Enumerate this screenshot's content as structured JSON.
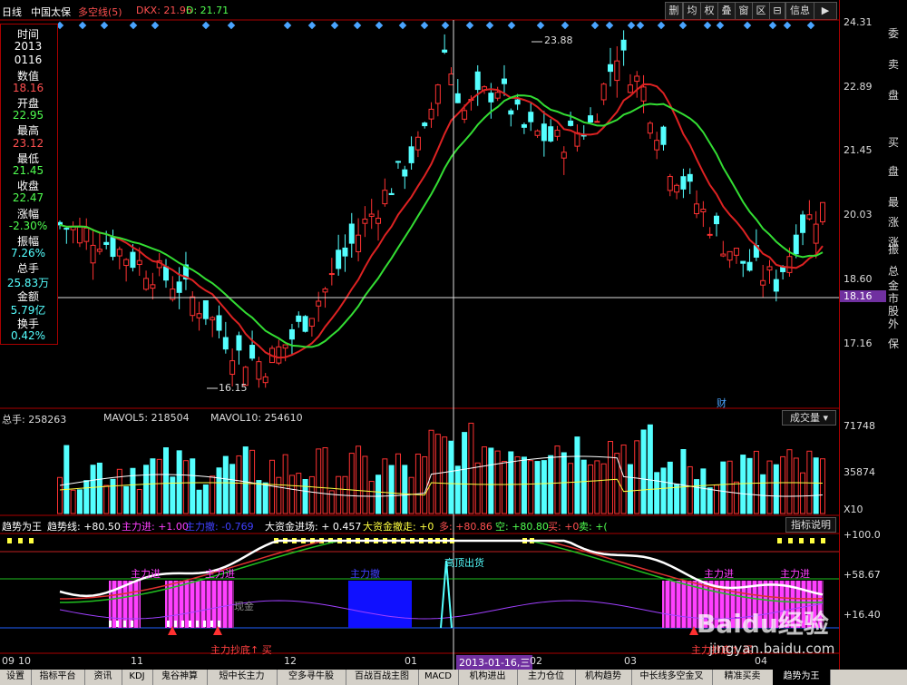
{
  "header": {
    "period": "日线",
    "stock_name": "中国太保",
    "indicator": "多空线(5)",
    "dkx_label": "DKX: 21.96",
    "d_label": "D: 21.71"
  },
  "toolbar": [
    "删",
    "均",
    "权",
    "叠",
    "窗",
    "区",
    "⊟",
    "信息",
    "▶"
  ],
  "colors": {
    "up": "#ff3232",
    "down": "#54ffff",
    "ma1": "#dd2222",
    "ma2": "#33dd33",
    "accent": "#7030a0"
  },
  "price_axis": [
    "24.31",
    "22.89",
    "21.45",
    "20.03",
    "18.60",
    "17.16"
  ],
  "current_price_tag": "18.16",
  "info_panel": [
    {
      "t": "时间",
      "c": "#fff"
    },
    {
      "t": "2013",
      "c": "#fff"
    },
    {
      "t": "0116",
      "c": "#fff"
    },
    {
      "t": "数值",
      "c": "#fff"
    },
    {
      "t": "18.16",
      "c": "#ff5050"
    },
    {
      "t": "开盘",
      "c": "#fff"
    },
    {
      "t": "22.95",
      "c": "#50ff50"
    },
    {
      "t": "最高",
      "c": "#fff"
    },
    {
      "t": "23.12",
      "c": "#ff5050"
    },
    {
      "t": "最低",
      "c": "#fff"
    },
    {
      "t": "21.45",
      "c": "#50ff50"
    },
    {
      "t": "收盘",
      "c": "#fff"
    },
    {
      "t": "22.47",
      "c": "#50ff50"
    },
    {
      "t": "涨幅",
      "c": "#fff"
    },
    {
      "t": "-2.30%",
      "c": "#50ff50"
    },
    {
      "t": "振幅",
      "c": "#fff"
    },
    {
      "t": "7.26%",
      "c": "#54ffff"
    },
    {
      "t": "总手",
      "c": "#fff"
    },
    {
      "t": "25.83万",
      "c": "#54ffff"
    },
    {
      "t": "金额",
      "c": "#fff"
    },
    {
      "t": "5.79亿",
      "c": "#54ffff"
    },
    {
      "t": "换手",
      "c": "#fff"
    },
    {
      "t": "0.42%",
      "c": "#54ffff"
    }
  ],
  "annotations": {
    "high": "23.88",
    "low": "16.15",
    "cai": "财"
  },
  "volume": {
    "label": "总手: 258263",
    "mavol5": "MAVOL5: 218504",
    "mavol10": "MAVOL10: 254610",
    "dropdown": "成交量",
    "axis": [
      "71748",
      "35874",
      "X10"
    ]
  },
  "trend": {
    "title": "趋势为王",
    "trend_line": "趋势线: +80.50",
    "zl_in": "主力进: +1.00",
    "zl_out": "主力撤: -0.769",
    "big_in": "大资金进场: + 0.457",
    "big_out": "大资金撤走: +0",
    "duo": "多: +80.86",
    "kong": "空: +80.80",
    "buy": "买: +0",
    "sell": "卖: +(",
    "btn": "指标说明",
    "axis": [
      "+100.0",
      "+58.67",
      "+16.40"
    ],
    "labels": {
      "zhulijin": "主力进",
      "zhulichе": "主力撤",
      "top": "高顶出货",
      "bottom": "主力抄底↑ 买",
      "xianjin": "现金"
    }
  },
  "dates": [
    "09",
    "10",
    "11",
    "12",
    "01",
    "2013-01-16,三",
    "02",
    "03",
    "04"
  ],
  "tabs": [
    "设置",
    "指标平台",
    "资讯",
    "KDJ",
    "鬼谷神算",
    "短中长主力",
    "空多寻牛股",
    "百战百战主图",
    "MACD",
    "机构进出",
    "主力仓位",
    "机构趋势",
    "中长线多空金叉",
    "精准买卖",
    "趋势为王"
  ],
  "side_labels": [
    "委",
    "卖",
    "盘",
    "买",
    "盘",
    "最",
    "涨",
    "涨",
    "振",
    "总",
    "金",
    "市",
    "股",
    "外",
    "保"
  ],
  "watermark": {
    "logo": "Baidu经验",
    "url": "jingyan.baidu.com"
  }
}
